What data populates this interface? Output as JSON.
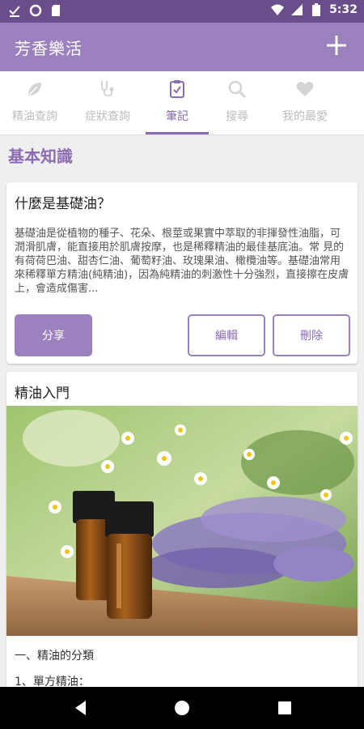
{
  "status_bar": {
    "time": "5:32",
    "icons": [
      "check-download-icon",
      "circle-icon",
      "sd-card-icon",
      "wifi-icon",
      "signal-icon",
      "battery-icon"
    ],
    "background": "#6a4e8c"
  },
  "app_bar": {
    "title": "芳香樂活",
    "action_icon": "plus-icon",
    "background": "#9b82bf"
  },
  "tabs": [
    {
      "label": "精油查詢",
      "icon": "leaf-icon",
      "active": false
    },
    {
      "label": "症狀查詢",
      "icon": "stethoscope-icon",
      "active": false
    },
    {
      "label": "筆記",
      "icon": "clipboard-icon",
      "active": true
    },
    {
      "label": "搜尋",
      "icon": "search-icon",
      "active": false
    },
    {
      "label": "我的最愛",
      "icon": "heart-icon",
      "active": false
    }
  ],
  "section": {
    "title": "基本知識"
  },
  "note_card": {
    "title": "什麼是基礎油？",
    "body": "基礎油是從植物的種子、花朵、根莖或果實中萃取的非揮發性油脂，可潤滑肌膚，能直接用於肌膚按摩，也是稀釋精油的最佳基底油。常 見的有荷荷巴油、甜杏仁油、葡萄籽油、玫瑰果油、橄欖油等。基礎油常用來稀釋單方精油(純精油)，因為純精油的刺激性十分強烈，直接擦在皮膚上，會造成傷害...",
    "share_label": "分享",
    "edit_label": "編輯",
    "delete_label": "刪除"
  },
  "intro_card": {
    "title": "精油入門",
    "image": "essential-oil-bottles-lavender-photo",
    "line1": "一、精油的分類",
    "line2": "1、單方精油："
  },
  "nav_bar": {
    "icons": [
      "back-icon",
      "home-icon",
      "recents-icon"
    ]
  },
  "colors": {
    "accent": "#8a6cb0",
    "inactive": "#bdbdbd"
  }
}
